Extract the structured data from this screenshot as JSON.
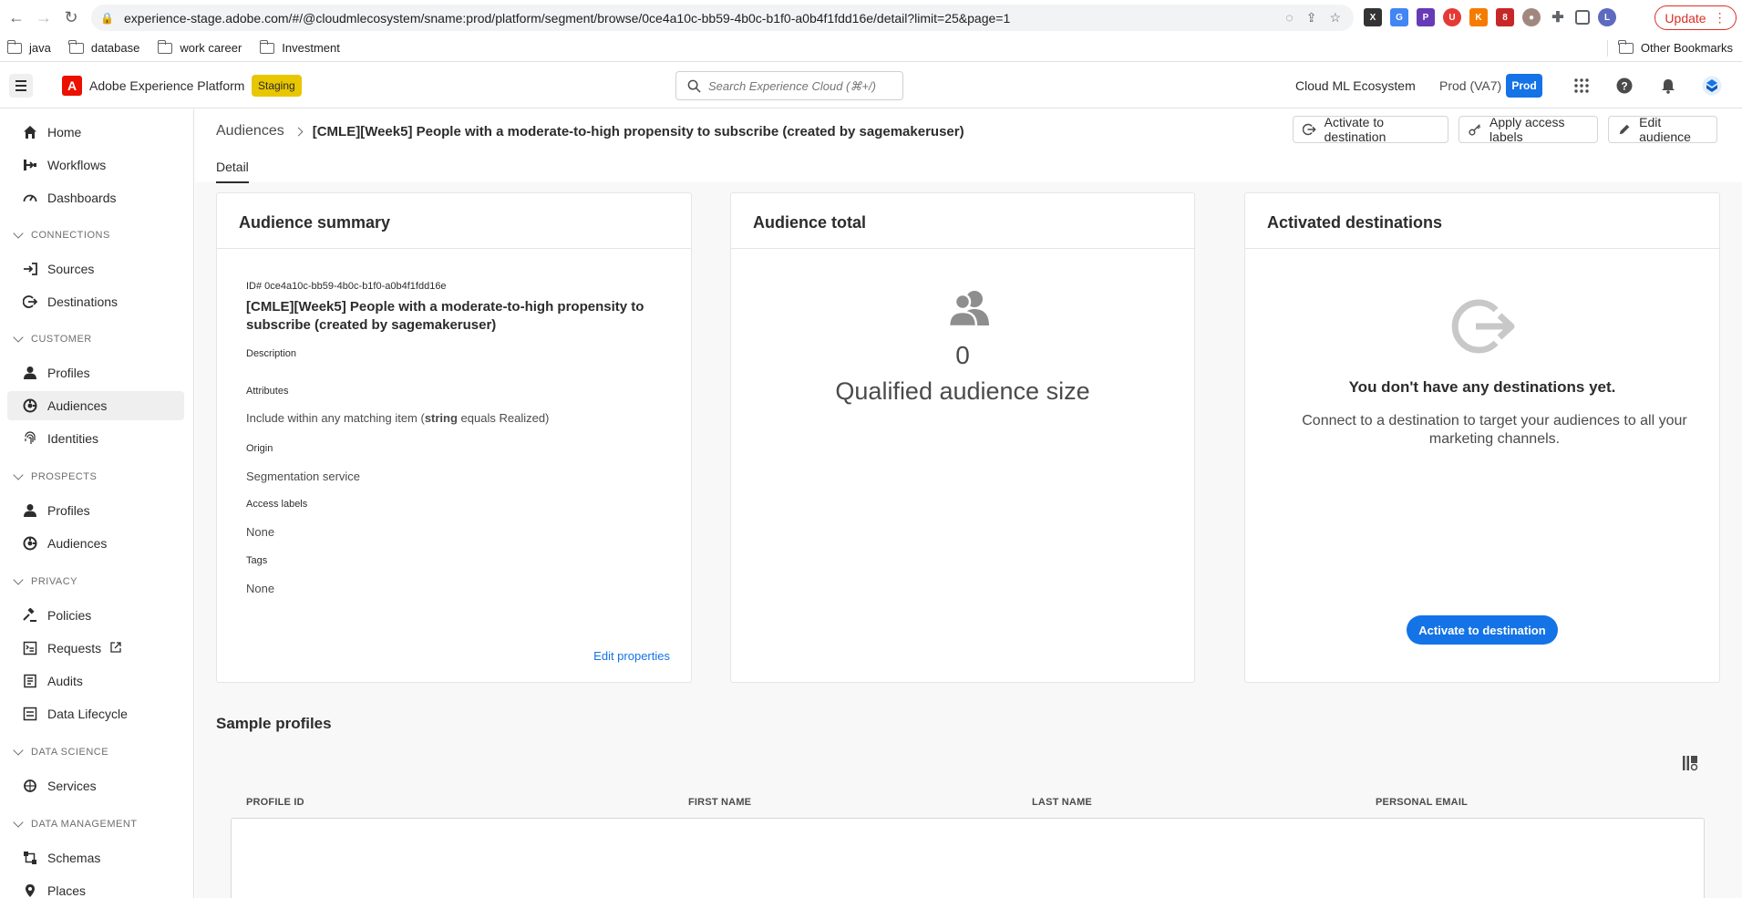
{
  "browser": {
    "url": "experience-stage.adobe.com/#/@cloudmlecosystem/sname:prod/platform/segment/browse/0ce4a10c-bb59-4b0c-b1f0-a0b4f1fdd16e/detail?limit=25&page=1",
    "update_label": "Update",
    "profile_initial": "L",
    "bookmarks": [
      "java",
      "database",
      "work career",
      "Investment"
    ],
    "other_bookmarks": "Other Bookmarks"
  },
  "header": {
    "app_title": "Adobe Experience Platform",
    "env_badge": "Staging",
    "search_placeholder": "Search Experience Cloud (⌘+/)",
    "org": "Cloud ML Ecosystem",
    "sandbox": "Prod (VA7)",
    "sandbox_badge": "Prod"
  },
  "sidebar": {
    "items_top": [
      {
        "label": "Home",
        "icon": "home-icon"
      },
      {
        "label": "Workflows",
        "icon": "workflow-icon"
      },
      {
        "label": "Dashboards",
        "icon": "dashboard-icon"
      }
    ],
    "sections": {
      "connections": "CONNECTIONS",
      "customer": "CUSTOMER",
      "prospects": "PROSPECTS",
      "privacy": "PRIVACY",
      "data_science": "DATA SCIENCE",
      "data_management": "DATA MANAGEMENT"
    },
    "sources": "Sources",
    "destinations": "Destinations",
    "customer_profiles": "Profiles",
    "customer_audiences": "Audiences",
    "identities": "Identities",
    "prospect_profiles": "Profiles",
    "prospect_audiences": "Audiences",
    "policies": "Policies",
    "requests": "Requests",
    "audits": "Audits",
    "data_lifecycle": "Data Lifecycle",
    "services": "Services",
    "schemas": "Schemas",
    "places": "Places"
  },
  "page": {
    "breadcrumb_root": "Audiences",
    "breadcrumb_current": "[CMLE][Week5] People with a moderate-to-high propensity to subscribe (created by sagemakeruser)",
    "actions": {
      "activate": "Activate to destination",
      "access_labels": "Apply access labels",
      "edit": "Edit audience"
    },
    "tab": "Detail"
  },
  "summary": {
    "title": "Audience summary",
    "id": "ID# 0ce4a10c-bb59-4b0c-b1f0-a0b4f1fdd16e",
    "name": "[CMLE][Week5] People with a moderate-to-high propensity to subscribe (created by sagemakeruser)",
    "description_label": "Description",
    "attributes_label": "Attributes",
    "attributes_prefix": "Include within any matching item (",
    "attributes_bold": "string",
    "attributes_suffix": " equals Realized)",
    "origin_label": "Origin",
    "origin_value": "Segmentation service",
    "access_label": "Access labels",
    "access_value": "None",
    "tags_label": "Tags",
    "tags_value": "None",
    "edit_link": "Edit properties"
  },
  "total": {
    "title": "Audience total",
    "count": "0",
    "label": "Qualified audience size"
  },
  "destinations": {
    "title": "Activated destinations",
    "empty_title": "You don't have any destinations yet.",
    "empty_desc": "Connect to a destination to target your audiences to all your marketing channels.",
    "button": "Activate to destination"
  },
  "sample_profiles": {
    "title": "Sample profiles",
    "columns": [
      "PROFILE ID",
      "FIRST NAME",
      "LAST NAME",
      "PERSONAL EMAIL"
    ]
  },
  "colors": {
    "accent": "#1473e6",
    "staging": "#e8c600",
    "adobe_red": "#eb1000"
  }
}
